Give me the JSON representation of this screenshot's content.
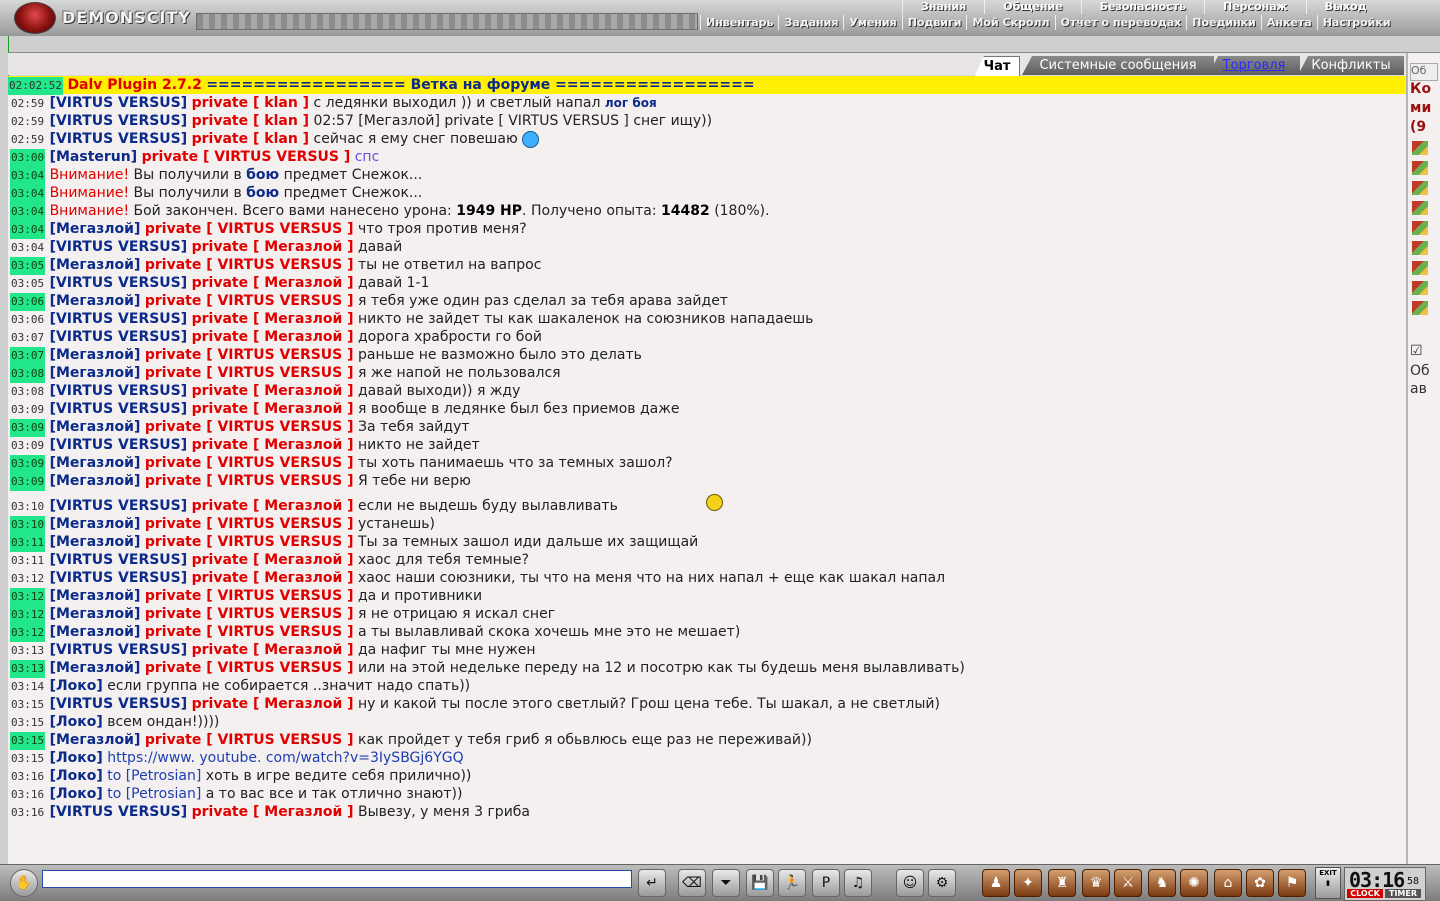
{
  "topbar": {
    "logo_text": "DEMONSCITY",
    "menu_top": [
      "Знания",
      "Общение",
      "Безопасность",
      "Персонаж",
      "Выход"
    ],
    "menu_bottom": [
      "Инвентарь",
      "Задания",
      "Умения",
      "Подвиги",
      "Мой Скролл",
      "Отчет о переводах",
      "Поединки",
      "Анкета",
      "Настройки"
    ]
  },
  "tabs": [
    {
      "label": "Чат",
      "active": true
    },
    {
      "label": "Системные сообщения",
      "active": false
    },
    {
      "label": "Торговля",
      "active": false
    },
    {
      "label": "Конфликты",
      "active": false
    }
  ],
  "chat": {
    "header": {
      "time": "02:02:52",
      "plugin": "Dalv Plugin 2.7.2",
      "forum": "================= Ветка на форуме ================="
    },
    "lines": [
      {
        "time": "02:59",
        "hl": false,
        "kind": "private",
        "from": "[VIRTUS VERSUS]",
        "priv": "private [ klan ]",
        "text": "с ледянки выходил )) и светлый напал",
        "extra": "лог боя"
      },
      {
        "time": "02:59",
        "hl": false,
        "kind": "private",
        "from": "[VIRTUS VERSUS]",
        "priv": "private [ klan ]",
        "text": "02:57 [Мегазлой] private [ VIRTUS VERSUS ] снег ищу))",
        "extra": ""
      },
      {
        "time": "02:59",
        "hl": false,
        "kind": "private",
        "from": "[VIRTUS VERSUS]",
        "priv": "private [ klan ]",
        "text": "сейчас я ему снег повешаю",
        "extra": ""
      },
      {
        "time": "03:00",
        "hl": true,
        "kind": "private",
        "from": "[Masterun]",
        "priv": "private [ VIRTUS VERSUS ]",
        "text": "спс",
        "extra": ""
      },
      {
        "time": "03:04",
        "hl": true,
        "kind": "warn",
        "warn": "Внимание!",
        "text": "Вы получили в",
        "bold": "бою",
        "rest": "предмет Снежок..."
      },
      {
        "time": "03:04",
        "hl": true,
        "kind": "warn",
        "warn": "Внимание!",
        "text": "Вы получили в",
        "bold": "бою",
        "rest": "предмет Снежок..."
      },
      {
        "time": "03:04",
        "hl": true,
        "kind": "battle",
        "warn": "Внимание!",
        "text": "Бой закончен. Всего вами нанесено урона:",
        "dmg": "1949 HP",
        "mid": ". Получено опыта:",
        "exp": "14482",
        "rest": "(180%)."
      },
      {
        "time": "03:04",
        "hl": true,
        "kind": "private",
        "from": "[Мегазлой]",
        "priv": "private [ VIRTUS VERSUS ]",
        "text": "что троя против меня?",
        "extra": ""
      },
      {
        "time": "03:04",
        "hl": false,
        "kind": "private",
        "from": "[VIRTUS VERSUS]",
        "priv": "private [ Мегазлой ]",
        "text": "давай",
        "extra": ""
      },
      {
        "time": "03:05",
        "hl": true,
        "kind": "private",
        "from": "[Мегазлой]",
        "priv": "private [ VIRTUS VERSUS ]",
        "text": "ты не ответил на вапрос",
        "extra": ""
      },
      {
        "time": "03:05",
        "hl": false,
        "kind": "private",
        "from": "[VIRTUS VERSUS]",
        "priv": "private [ Мегазлой ]",
        "text": "давай 1-1",
        "extra": ""
      },
      {
        "time": "03:06",
        "hl": true,
        "kind": "private",
        "from": "[Мегазлой]",
        "priv": "private [ VIRTUS VERSUS ]",
        "text": "я тебя уже один раз сделал за тебя арава зайдет",
        "extra": ""
      },
      {
        "time": "03:06",
        "hl": false,
        "kind": "private",
        "from": "[VIRTUS VERSUS]",
        "priv": "private [ Мегазлой ]",
        "text": "никто не зайдет ты как шакаленок на союзников нападаешь",
        "extra": ""
      },
      {
        "time": "03:07",
        "hl": false,
        "kind": "private",
        "from": "[VIRTUS VERSUS]",
        "priv": "private [ Мегазлой ]",
        "text": "дорога храбрости го бой",
        "extra": ""
      },
      {
        "time": "03:07",
        "hl": true,
        "kind": "private",
        "from": "[Мегазлой]",
        "priv": "private [ VIRTUS VERSUS ]",
        "text": "раньше не вазможно было это делать",
        "extra": ""
      },
      {
        "time": "03:08",
        "hl": true,
        "kind": "private",
        "from": "[Мегазлой]",
        "priv": "private [ VIRTUS VERSUS ]",
        "text": "я же напой не пользовался",
        "extra": ""
      },
      {
        "time": "03:08",
        "hl": false,
        "kind": "private",
        "from": "[VIRTUS VERSUS]",
        "priv": "private [ Мегазлой ]",
        "text": "давай выходи)) я жду",
        "extra": ""
      },
      {
        "time": "03:09",
        "hl": false,
        "kind": "private",
        "from": "[VIRTUS VERSUS]",
        "priv": "private [ Мегазлой ]",
        "text": "я вообще в ледянке был без приемов даже",
        "extra": ""
      },
      {
        "time": "03:09",
        "hl": true,
        "kind": "private",
        "from": "[Мегазлой]",
        "priv": "private [ VIRTUS VERSUS ]",
        "text": "За тебя зайдут",
        "extra": ""
      },
      {
        "time": "03:09",
        "hl": false,
        "kind": "private",
        "from": "[VIRTUS VERSUS]",
        "priv": "private [ Мегазлой ]",
        "text": "никто не зайдет",
        "extra": ""
      },
      {
        "time": "03:09",
        "hl": true,
        "kind": "private",
        "from": "[Мегазлой]",
        "priv": "private [ VIRTUS VERSUS ]",
        "text": "ты хоть панимаешь что за темных зашол?",
        "extra": ""
      },
      {
        "time": "03:09",
        "hl": true,
        "kind": "private",
        "from": "[Мегазлой]",
        "priv": "private [ VIRTUS VERSUS ]",
        "text": "Я тебе ни верю",
        "extra": ""
      },
      {
        "time": "03:10",
        "hl": false,
        "kind": "private",
        "from": "[VIRTUS VERSUS]",
        "priv": "private [ Мегазлой ]",
        "text": "если не выдешь буду вылавливать",
        "extra": ""
      },
      {
        "time": "03:10",
        "hl": true,
        "kind": "private",
        "from": "[Мегазлой]",
        "priv": "private [ VIRTUS VERSUS ]",
        "text": "устанешь)",
        "extra": ""
      },
      {
        "time": "03:11",
        "hl": true,
        "kind": "private",
        "from": "[Мегазлой]",
        "priv": "private [ VIRTUS VERSUS ]",
        "text": "Ты за темных зашол иди дальше их защищай",
        "extra": ""
      },
      {
        "time": "03:11",
        "hl": false,
        "kind": "private",
        "from": "[VIRTUS VERSUS]",
        "priv": "private [ Мегазлой ]",
        "text": "хаос для тебя темные?",
        "extra": ""
      },
      {
        "time": "03:12",
        "hl": false,
        "kind": "private",
        "from": "[VIRTUS VERSUS]",
        "priv": "private [ Мегазлой ]",
        "text": "хаос наши союзники, ты что на меня что на них напал + еще как шакал напал",
        "extra": ""
      },
      {
        "time": "03:12",
        "hl": true,
        "kind": "private",
        "from": "[Мегазлой]",
        "priv": "private [ VIRTUS VERSUS ]",
        "text": "да и противники",
        "extra": ""
      },
      {
        "time": "03:12",
        "hl": true,
        "kind": "private",
        "from": "[Мегазлой]",
        "priv": "private [ VIRTUS VERSUS ]",
        "text": "я не отрицаю я искал снег",
        "extra": ""
      },
      {
        "time": "03:12",
        "hl": true,
        "kind": "private",
        "from": "[Мегазлой]",
        "priv": "private [ VIRTUS VERSUS ]",
        "text": "а ты вылавливай скока хочешь мне это не мешает)",
        "extra": ""
      },
      {
        "time": "03:13",
        "hl": false,
        "kind": "private",
        "from": "[VIRTUS VERSUS]",
        "priv": "private [ Мегазлой ]",
        "text": "да нафиг ты мне нужен",
        "extra": ""
      },
      {
        "time": "03:13",
        "hl": true,
        "kind": "private",
        "from": "[Мегазлой]",
        "priv": "private [ VIRTUS VERSUS ]",
        "text": "или на этой недельке переду на 12 и посотрю как ты будешь меня вылавливать)",
        "extra": ""
      },
      {
        "time": "03:14",
        "hl": false,
        "kind": "public",
        "from": "[Локо]",
        "text": "если группа не собирается ..значит надо спать))"
      },
      {
        "time": "03:15",
        "hl": false,
        "kind": "private",
        "from": "[VIRTUS VERSUS]",
        "priv": "private [ Мегазлой ]",
        "text": "ну и какой ты после этого светлый? Грош цена тебе. Ты шакал, а не светлый)",
        "extra": ""
      },
      {
        "time": "03:15",
        "hl": false,
        "kind": "public",
        "from": "[Локо]",
        "text": "всем ондан!))))"
      },
      {
        "time": "03:15",
        "hl": true,
        "kind": "private",
        "from": "[Мегазлой]",
        "priv": "private [ VIRTUS VERSUS ]",
        "text": "как пройдет у тебя гриб я обьвлюсь еще раз не переживай))",
        "extra": ""
      },
      {
        "time": "03:15",
        "hl": false,
        "kind": "link",
        "from": "[Локо]",
        "text": "https://www. youtube. com/watch?v=3IySBGj6YGQ"
      },
      {
        "time": "03:16",
        "hl": false,
        "kind": "to",
        "from": "[Локо]",
        "to": "to [Petrosian]",
        "text": "хоть в игре ведите себя прилично))"
      },
      {
        "time": "03:16",
        "hl": false,
        "kind": "to",
        "from": "[Локо]",
        "to": "to [Petrosian]",
        "text": "а то вас все и так отлично знают))"
      },
      {
        "time": "03:16",
        "hl": false,
        "kind": "private",
        "from": "[VIRTUS VERSUS]",
        "priv": "private [ Мегазлой ]",
        "text": "Вывезу, у меня 3 гриба",
        "extra": ""
      }
    ]
  },
  "right_panel": {
    "top_label": "Об",
    "red_lines": [
      "Ко",
      "ми",
      "(9"
    ],
    "bottom_lines": [
      "Об",
      "ав"
    ]
  },
  "bottombar": {
    "input_value": "",
    "exit_label": "EXIT",
    "clock_time": "03:16",
    "clock_seconds": "58",
    "clock_label": "CLOCK",
    "timer_label": "TIMER"
  },
  "colors": {
    "name_blue": "#0b2a8a",
    "private_red": "#e00000",
    "time_highlight": "#22e68a",
    "header_yellow": "#ffef00"
  }
}
